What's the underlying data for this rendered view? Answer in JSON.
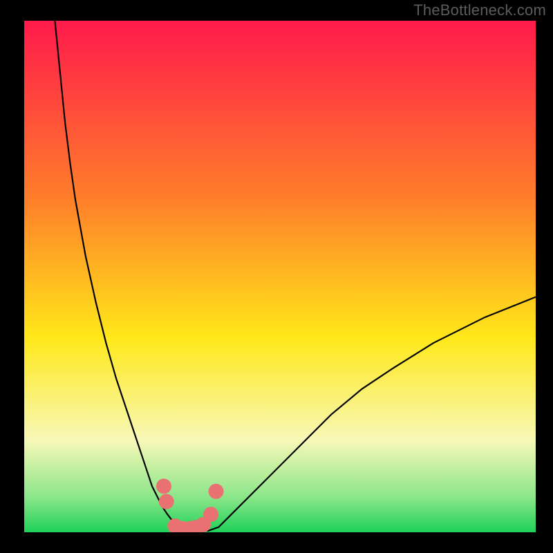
{
  "watermark": "TheBottleneck.com",
  "colors": {
    "frame": "#000000",
    "gradient_top": "#ff1a4b",
    "gradient_mid1": "#ff7f2a",
    "gradient_mid2": "#ffe81a",
    "gradient_low1": "#f7f8b7",
    "gradient_low2": "#8de68a",
    "gradient_bottom": "#1fd15a",
    "curve": "#000000",
    "marker": "#e97171"
  },
  "chart_data": {
    "type": "line",
    "title": "",
    "xlabel": "",
    "ylabel": "",
    "xlim": [
      0,
      100
    ],
    "ylim": [
      0,
      100
    ],
    "series": [
      {
        "name": "bottleneck-curve",
        "x": [
          6,
          7,
          8,
          9,
          10,
          12,
          14,
          16,
          18,
          20,
          22,
          24,
          25,
          26,
          27,
          28,
          29,
          30,
          31,
          32,
          33,
          34,
          36,
          38,
          40,
          44,
          48,
          52,
          56,
          60,
          66,
          72,
          80,
          90,
          100
        ],
        "values": [
          100,
          90,
          80,
          72,
          65,
          54,
          45,
          37,
          30,
          24,
          18,
          12,
          9,
          7,
          5,
          3.5,
          2.2,
          1.5,
          1,
          0.6,
          0.4,
          0.3,
          0.3,
          1,
          3,
          7,
          11,
          15,
          19,
          23,
          28,
          32,
          37,
          42,
          46
        ]
      }
    ],
    "markers": {
      "name": "highlight-points",
      "x": [
        27.3,
        27.8,
        29.5,
        31,
        32.5,
        33.5,
        35,
        36.5,
        37.5
      ],
      "values": [
        9,
        6,
        1.2,
        0.7,
        0.7,
        0.9,
        1.5,
        3.5,
        8
      ]
    }
  }
}
